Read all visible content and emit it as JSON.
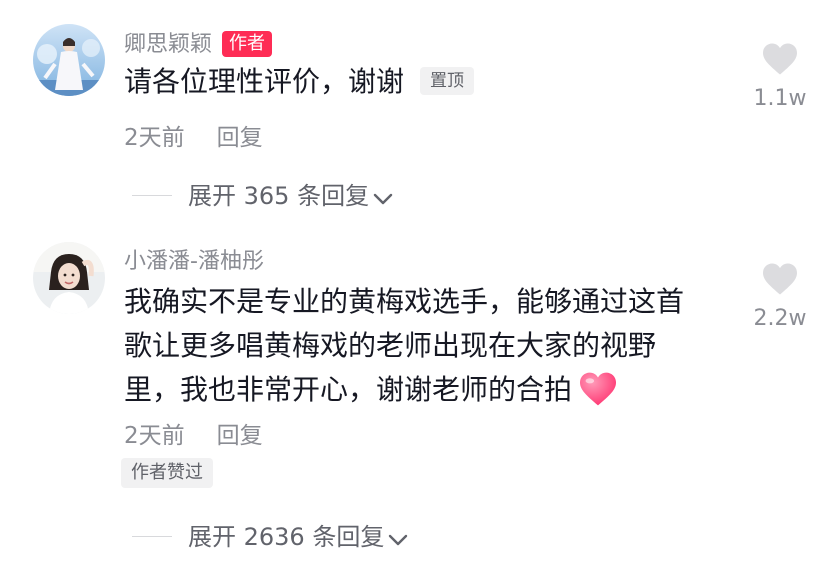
{
  "comments": [
    {
      "username": "卿思颖颖",
      "author_badge": "作者",
      "text": "请各位理性评价，谢谢",
      "pin_label": "置顶",
      "time": "2天前",
      "reply_label": "回复",
      "likes": "1.1w",
      "expand_label": "展开 365 条回复"
    },
    {
      "username": "小潘潘-潘柚彤",
      "text_lines": [
        "我确实不是专业的黄梅戏选手，能够通过这首",
        "歌让更多唱黄梅戏的老师出现在大家的视野",
        "里，我也非常开心，谢谢老师的合拍"
      ],
      "time": "2天前",
      "reply_label": "回复",
      "author_liked": "作者赞过",
      "likes": "2.2w",
      "expand_label": "展开 2636 条回复"
    }
  ],
  "colors": {
    "accent": "#fe2c55",
    "text_primary": "#161823",
    "text_secondary": "#8a8c93",
    "badge_bg": "#f1f1f2",
    "heart_gray": "#dcdcdf"
  },
  "icons": {
    "like": "heart-icon",
    "expand": "chevron-down-icon",
    "emoji": "pink-heart-emoji"
  }
}
